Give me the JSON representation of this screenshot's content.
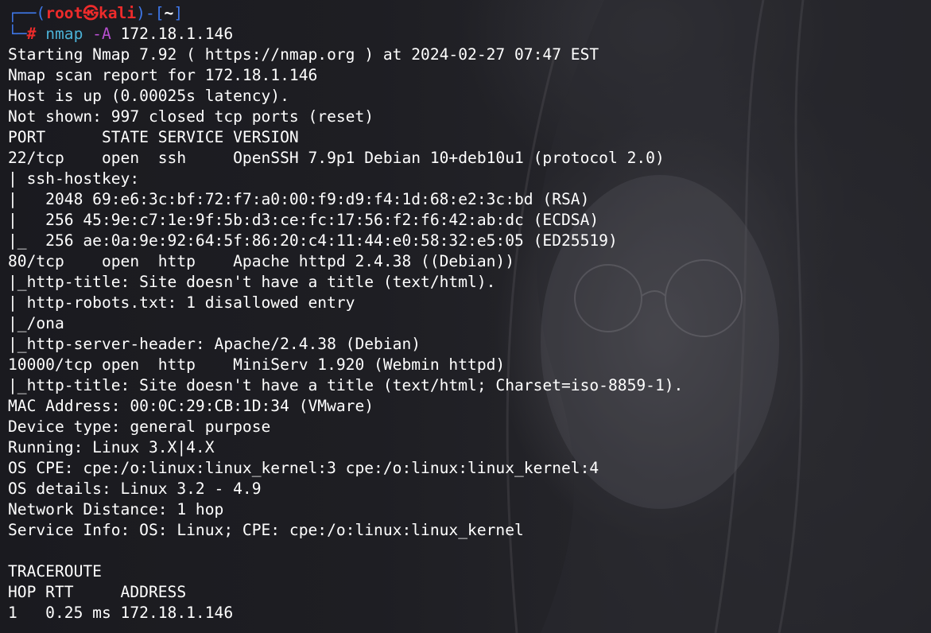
{
  "prompt": {
    "corner_top": "┌──(",
    "user": "root",
    "at_symbol": "㉿",
    "host": "kali",
    "sep": ")-[",
    "cwd": "~",
    "close": "]",
    "corner_bottom": "└─",
    "symbol": "#",
    "command": "nmap",
    "flag": "-A",
    "target": "172.18.1.146"
  },
  "output": [
    "Starting Nmap 7.92 ( https://nmap.org ) at 2024-02-27 07:47 EST",
    "Nmap scan report for 172.18.1.146",
    "Host is up (0.00025s latency).",
    "Not shown: 997 closed tcp ports (reset)",
    "PORT      STATE SERVICE VERSION",
    "22/tcp    open  ssh     OpenSSH 7.9p1 Debian 10+deb10u1 (protocol 2.0)",
    "| ssh-hostkey: ",
    "|   2048 69:e6:3c:bf:72:f7:a0:00:f9:d9:f4:1d:68:e2:3c:bd (RSA)",
    "|   256 45:9e:c7:1e:9f:5b:d3:ce:fc:17:56:f2:f6:42:ab:dc (ECDSA)",
    "|_  256 ae:0a:9e:92:64:5f:86:20:c4:11:44:e0:58:32:e5:05 (ED25519)",
    "80/tcp    open  http    Apache httpd 2.4.38 ((Debian))",
    "|_http-title: Site doesn't have a title (text/html).",
    "| http-robots.txt: 1 disallowed entry ",
    "|_/ona",
    "|_http-server-header: Apache/2.4.38 (Debian)",
    "10000/tcp open  http    MiniServ 1.920 (Webmin httpd)",
    "|_http-title: Site doesn't have a title (text/html; Charset=iso-8859-1).",
    "MAC Address: 00:0C:29:CB:1D:34 (VMware)",
    "Device type: general purpose",
    "Running: Linux 3.X|4.X",
    "OS CPE: cpe:/o:linux:linux_kernel:3 cpe:/o:linux:linux_kernel:4",
    "OS details: Linux 3.2 - 4.9",
    "Network Distance: 1 hop",
    "Service Info: OS: Linux; CPE: cpe:/o:linux:linux_kernel",
    "",
    "TRACEROUTE",
    "HOP RTT     ADDRESS",
    "1   0.25 ms 172.18.1.146"
  ]
}
